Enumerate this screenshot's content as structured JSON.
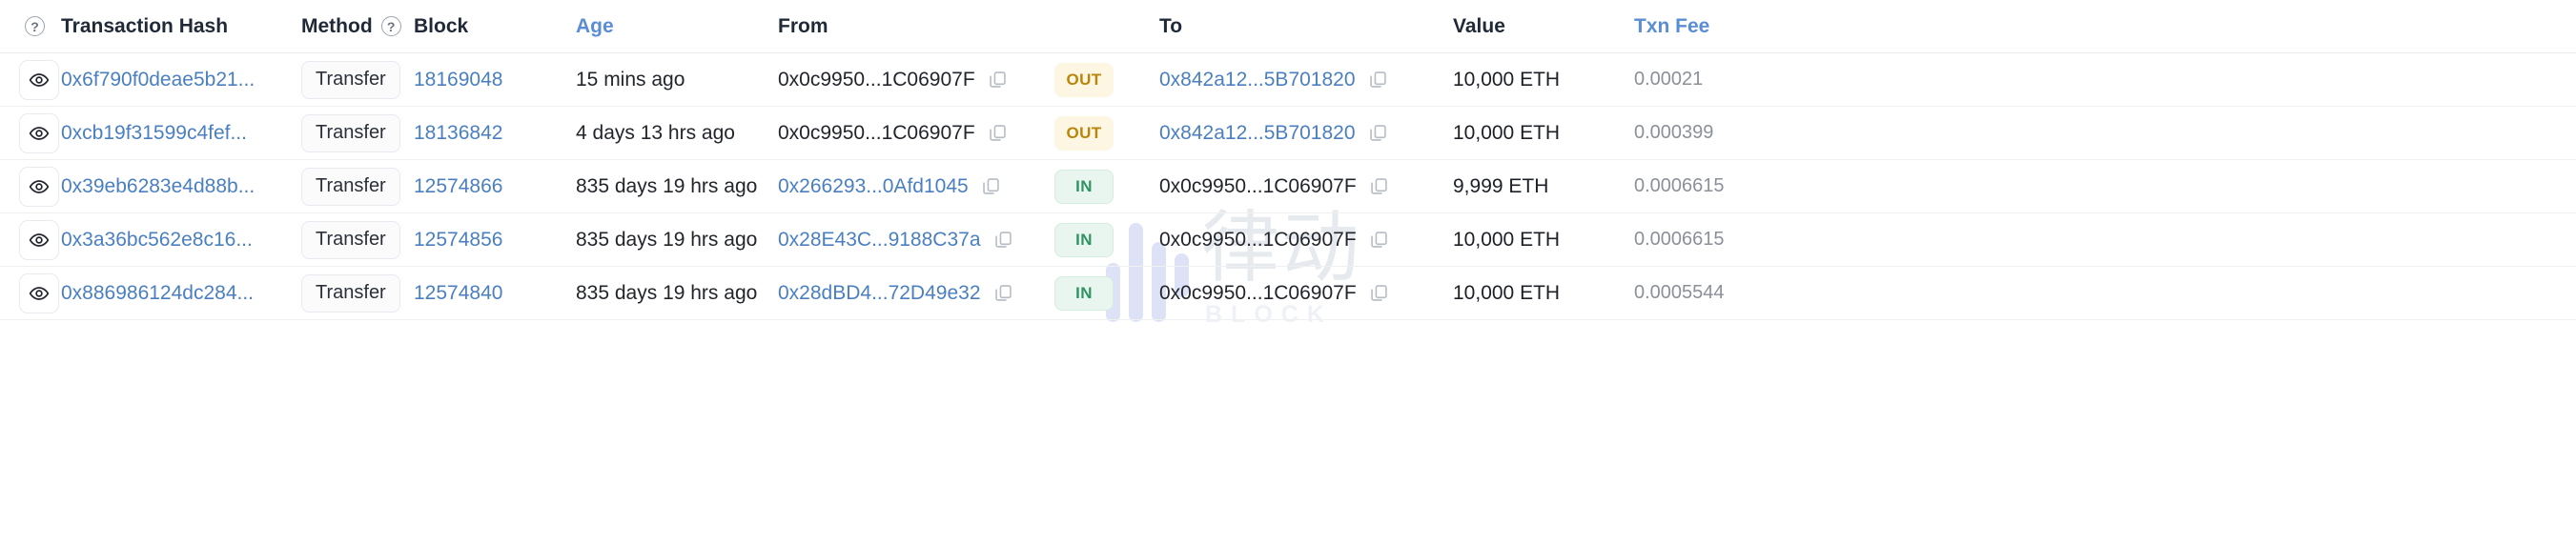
{
  "table": {
    "columns": {
      "info_icon": "question-circle",
      "transaction_hash": "Transaction Hash",
      "method": "Method",
      "method_info_icon": "question-circle",
      "block": "Block",
      "age": "Age",
      "from": "From",
      "to": "To",
      "value": "Value",
      "txn_fee": "Txn Fee"
    },
    "colors": {
      "link": "#4a7fc1",
      "out_badge_bg": "#fdf6e3",
      "out_badge_text": "#b8860b",
      "in_badge_bg": "#e9f6ef",
      "in_badge_text": "#2f9462",
      "fee_text": "#8b9099"
    },
    "rows": [
      {
        "eye_icon": "eye-icon",
        "hash": "0x6f790f0deae5b21...",
        "method": "Transfer",
        "block": "18169048",
        "age": "15 mins ago",
        "from": "0x0c9950...1C06907F",
        "from_copy_icon": "copy-icon",
        "direction": "OUT",
        "to": "0x842a12...5B701820",
        "to_copy_icon": "copy-icon",
        "value": "10,000 ETH",
        "fee": "0.00021",
        "from_is_link": false,
        "to_is_link": true
      },
      {
        "eye_icon": "eye-icon",
        "hash": "0xcb19f31599c4fef...",
        "method": "Transfer",
        "block": "18136842",
        "age": "4 days 13 hrs ago",
        "from": "0x0c9950...1C06907F",
        "from_copy_icon": "copy-icon",
        "direction": "OUT",
        "to": "0x842a12...5B701820",
        "to_copy_icon": "copy-icon",
        "value": "10,000 ETH",
        "fee": "0.000399",
        "from_is_link": false,
        "to_is_link": true
      },
      {
        "eye_icon": "eye-icon",
        "hash": "0x39eb6283e4d88b...",
        "method": "Transfer",
        "block": "12574866",
        "age": "835 days 19 hrs ago",
        "from": "0x266293...0Afd1045",
        "from_copy_icon": "copy-icon",
        "direction": "IN",
        "to": "0x0c9950...1C06907F",
        "to_copy_icon": "copy-icon",
        "value": "9,999 ETH",
        "fee": "0.0006615",
        "from_is_link": true,
        "to_is_link": false
      },
      {
        "eye_icon": "eye-icon",
        "hash": "0x3a36bc562e8c16...",
        "method": "Transfer",
        "block": "12574856",
        "age": "835 days 19 hrs ago",
        "from": "0x28E43C...9188C37a",
        "from_copy_icon": "copy-icon",
        "direction": "IN",
        "to": "0x0c9950...1C06907F",
        "to_copy_icon": "copy-icon",
        "value": "10,000 ETH",
        "fee": "0.0006615",
        "from_is_link": true,
        "to_is_link": false
      },
      {
        "eye_icon": "eye-icon",
        "hash": "0x886986124dc284...",
        "method": "Transfer",
        "block": "12574840",
        "age": "835 days 19 hrs ago",
        "from": "0x28dBD4...72D49e32",
        "from_copy_icon": "copy-icon",
        "direction": "IN",
        "to": "0x0c9950...1C06907F",
        "to_copy_icon": "copy-icon",
        "value": "10,000 ETH",
        "fee": "0.0005544",
        "from_is_link": true,
        "to_is_link": false
      }
    ]
  },
  "watermark": {
    "cn_text": "律动",
    "en_text": "BLOCK",
    "logo_icon": "bar-chart-logo"
  }
}
